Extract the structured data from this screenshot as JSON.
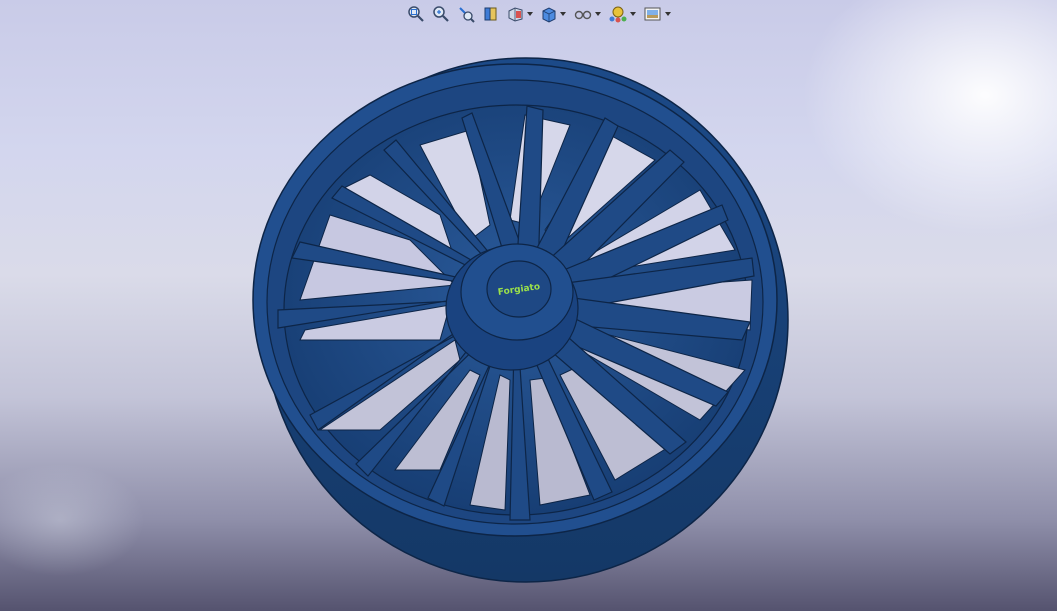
{
  "toolbar": {
    "buttons": [
      {
        "name": "zoom-to-fit-icon",
        "dropdown": false
      },
      {
        "name": "zoom-to-area-icon",
        "dropdown": false
      },
      {
        "name": "previous-view-icon",
        "dropdown": false
      },
      {
        "name": "section-view-icon",
        "dropdown": false
      },
      {
        "name": "view-orientation-icon",
        "dropdown": true
      },
      {
        "name": "display-style-icon",
        "dropdown": true
      },
      {
        "name": "hide-show-items-icon",
        "dropdown": true
      },
      {
        "name": "edit-appearance-icon",
        "dropdown": true
      },
      {
        "name": "apply-scene-icon",
        "dropdown": true
      }
    ]
  },
  "model": {
    "logo_text": "Forgiato",
    "part_color": "#1f4a86",
    "edge_color": "#0d2547"
  }
}
